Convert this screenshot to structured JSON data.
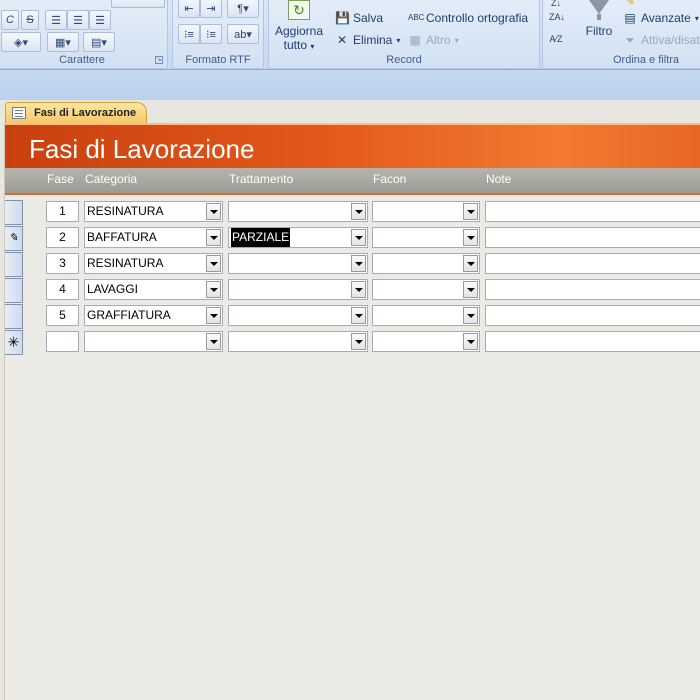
{
  "ribbon": {
    "carattere": {
      "label": "Carattere",
      "italic": "C",
      "strike": "S"
    },
    "formato_rtf": {
      "label": "Formato RTF"
    },
    "record": {
      "label": "Record",
      "aggiorna_line1": "Aggiorna",
      "aggiorna_line2": "tutto",
      "salva": "Salva",
      "elimina": "Elimina",
      "controllo": "Controllo ortografia",
      "altro": "Altro"
    },
    "ordina": {
      "label": "Ordina e filtra",
      "filtro": "Filtro",
      "avanzate": "Avanzate",
      "attiva": "Attiva/disatt"
    }
  },
  "tab": {
    "label": "Fasi di Lavorazione"
  },
  "form": {
    "title": "Fasi di Lavorazione",
    "headers": {
      "fase": "Fase",
      "categoria": "Categoria",
      "trattamento": "Trattamento",
      "facon": "Facon",
      "note": "Note"
    },
    "rows": [
      {
        "fase": "1",
        "categoria": "RESINATURA",
        "trattamento": "",
        "facon": "",
        "note": ""
      },
      {
        "fase": "2",
        "categoria": "BAFFATURA",
        "trattamento": "PARZIALE",
        "facon": "",
        "note": ""
      },
      {
        "fase": "3",
        "categoria": "RESINATURA",
        "trattamento": "",
        "facon": "",
        "note": ""
      },
      {
        "fase": "4",
        "categoria": "LAVAGGI",
        "trattamento": "",
        "facon": "",
        "note": ""
      },
      {
        "fase": "5",
        "categoria": "GRAFFIATURA",
        "trattamento": "",
        "facon": "",
        "note": ""
      },
      {
        "fase": "",
        "categoria": "",
        "trattamento": "",
        "facon": "",
        "note": ""
      }
    ],
    "selectors": [
      "",
      "✎",
      "",
      "",
      "",
      "✳"
    ]
  }
}
